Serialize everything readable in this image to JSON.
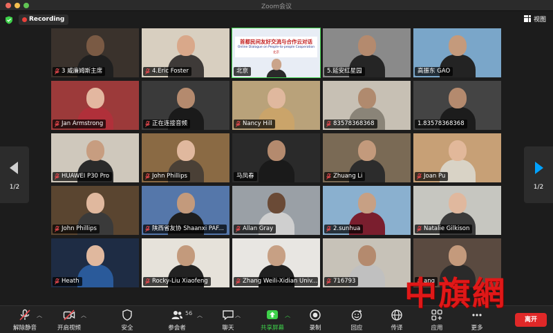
{
  "window": {
    "title": "Zoom会议"
  },
  "top": {
    "recording_label": "Recording",
    "view_label": "视图"
  },
  "pager": {
    "left_page": "1/2",
    "right_page": "1/2"
  },
  "participants": [
    {
      "name": "3 威廉姆斯主席",
      "muted": true,
      "bg": "#3a322c",
      "skin": "#7a5a44",
      "shirt": "#1f1f1f"
    },
    {
      "name": "4.Eric Foster",
      "muted": true,
      "bg": "#d8cfc0",
      "skin": "#d9a88a",
      "shirt": "#3e3a38"
    },
    {
      "name": "北京",
      "muted": false,
      "bg": "#e8edf5",
      "skin": "#caa48a",
      "shirt": "#2a2a2a",
      "active": true,
      "banner_title": "首都民间友好交流与合作云对话",
      "banner_sub": "Online Dialogue on People-to-people Cooperation",
      "banner_city": "北京"
    },
    {
      "name": "5.延安红星园",
      "muted": false,
      "bg": "#8a8a8a",
      "skin": "#b48a6e",
      "shirt": "#252525"
    },
    {
      "name": "高振东 GAO",
      "muted": false,
      "bg": "#7aa6c9",
      "skin": "#c49a7c",
      "shirt": "#232323"
    },
    {
      "name": "Jan Armstrong",
      "muted": true,
      "bg": "#9c3a3a",
      "skin": "#e3b7a0",
      "shirt": "#b0303a"
    },
    {
      "name": "正在连接音频",
      "muted": true,
      "bg": "#3a3a3a",
      "skin": "#b48a6e",
      "shirt": "#1a1a1a"
    },
    {
      "name": "Nancy Hill",
      "muted": true,
      "bg": "#b9a27a",
      "skin": "#e0b89e",
      "shirt": "#caa46a"
    },
    {
      "name": "83578368368",
      "muted": true,
      "bg": "#c7c0b4",
      "skin": "#b08a6e",
      "shirt": "#8a8478"
    },
    {
      "name": "1.83578368368",
      "muted": false,
      "bg": "#444444",
      "skin": "#b48a6e",
      "shirt": "#1c1c1c"
    },
    {
      "name": "HUAWEI P30 Pro",
      "muted": true,
      "bg": "#cfc8bc",
      "skin": "#c79d80",
      "shirt": "#2a2a2a"
    },
    {
      "name": "John Phillips",
      "muted": true,
      "bg": "#8a6a44",
      "skin": "#e0b89e",
      "shirt": "#4a4036"
    },
    {
      "name": "马凤春",
      "muted": false,
      "bg": "#2a2a2a",
      "skin": "#b48a6e",
      "shirt": "#1a1a1a"
    },
    {
      "name": "Zhuang Li",
      "muted": true,
      "bg": "#7a6a55",
      "skin": "#c39a7c",
      "shirt": "#2c2c2c"
    },
    {
      "name": "Joan Pu",
      "muted": true,
      "bg": "#c7a076",
      "skin": "#e2b89a",
      "shirt": "#d9d3c6"
    },
    {
      "name": "John Phillips",
      "muted": true,
      "bg": "#5a4530",
      "skin": "#e0b89e",
      "shirt": "#3a3a3a"
    },
    {
      "name": "陕西省友协 Shaanxi PAF...",
      "muted": true,
      "bg": "#5577aa",
      "skin": "#c39a7c",
      "shirt": "#1e1e1e"
    },
    {
      "name": "Allan Gray",
      "muted": true,
      "bg": "#9aa0a6",
      "skin": "#6a4a36",
      "shirt": "#cfcfcf"
    },
    {
      "name": "2.sunhua",
      "muted": true,
      "bg": "#8ab0cf",
      "skin": "#c7a084",
      "shirt": "#7a1e2e"
    },
    {
      "name": "Natalie Gilkison",
      "muted": true,
      "bg": "#c6c6c0",
      "skin": "#e0b89e",
      "shirt": "#3a3a3a"
    },
    {
      "name": "Heath",
      "muted": true,
      "bg": "#1e2c44",
      "skin": "#e0b89e",
      "shirt": "#2a5a9a"
    },
    {
      "name": "Rocky-Liu Xiaofeng",
      "muted": true,
      "bg": "#e6e2da",
      "skin": "#c39a7c",
      "shirt": "#222222"
    },
    {
      "name": "Zhang Weili-Xidian Univ...",
      "muted": true,
      "bg": "#e8e6e2",
      "skin": "#c7a084",
      "shirt": "#202020"
    },
    {
      "name": "716793",
      "muted": true,
      "bg": "#c7c2b8",
      "skin": "#b48a6e",
      "shirt": "#c0c0c0"
    },
    {
      "name": "ang",
      "muted": true,
      "bg": "#5a4a40",
      "skin": "#c49a7c",
      "shirt": "#2a2a2a"
    }
  ],
  "toolbar": {
    "unmute": "解除静音",
    "start_video": "开启视频",
    "security": "安全",
    "participants": "参会者",
    "participants_count": "56",
    "chat": "聊天",
    "share_screen": "共享屏幕",
    "record": "录制",
    "reactions": "回应",
    "translate": "传译",
    "apps": "应用",
    "more": "更多",
    "leave": "离开"
  },
  "watermark": {
    "text": "中旗網"
  },
  "colors": {
    "accent_green": "#3ed14a",
    "leave_red": "#e02828",
    "pager_blue": "#00a2ff"
  }
}
